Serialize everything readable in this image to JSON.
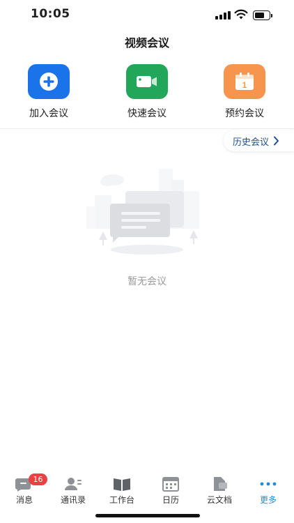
{
  "status_bar": {
    "time": "10:05"
  },
  "header": {
    "title": "视频会议"
  },
  "actions": [
    {
      "label": "加入会议",
      "icon": "plus-circle-icon",
      "color": "#1a73e8"
    },
    {
      "label": "快速会议",
      "icon": "video-camera-icon",
      "color": "#21a65a"
    },
    {
      "label": "预约会议",
      "icon": "calendar-icon",
      "color": "#f7954e"
    }
  ],
  "history": {
    "label": "历史会议",
    "icon": "chevron-right-icon"
  },
  "empty_state": {
    "text": "暂无会议",
    "icon": "empty-chat-illustration"
  },
  "tabbar": {
    "items": [
      {
        "label": "消息",
        "icon": "message-icon",
        "badge": "16"
      },
      {
        "label": "通讯录",
        "icon": "contacts-icon"
      },
      {
        "label": "工作台",
        "icon": "workbench-book-icon"
      },
      {
        "label": "日历",
        "icon": "calendar-tab-icon"
      },
      {
        "label": "云文档",
        "icon": "cloud-doc-icon"
      },
      {
        "label": "更多",
        "icon": "more-dots-icon",
        "active": true
      }
    ],
    "active_color": "#1c8fd6"
  }
}
